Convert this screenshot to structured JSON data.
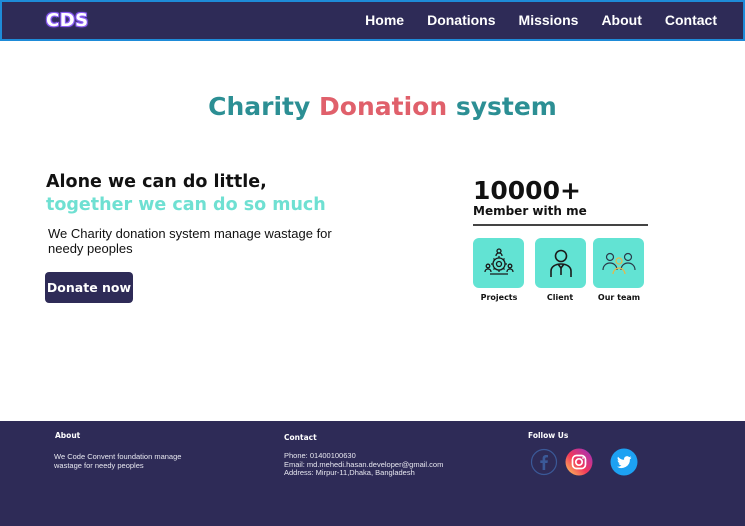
{
  "header": {
    "logo": "CDS",
    "nav": [
      "Home",
      "Donations",
      "Missions",
      "About",
      "Contact"
    ]
  },
  "hero": {
    "title_part1": "Charity",
    "title_part2": "Donation",
    "title_part3": "system"
  },
  "intro": {
    "tagline_line1": "Alone we can do little,",
    "tagline_line2": "together we can do so much",
    "description": "We Charity donation system manage wastage for needy peoples",
    "button_label": "Donate now"
  },
  "stats": {
    "count": "10000+",
    "label": "Member with me",
    "cards": [
      {
        "label": "Projects",
        "icon": "gear-people-icon"
      },
      {
        "label": "Client",
        "icon": "person-icon"
      },
      {
        "label": "Our team",
        "icon": "team-icon"
      }
    ]
  },
  "footer": {
    "about_heading": "About",
    "about_text": "We Code Convent foundation manage wastage for needy peoples",
    "contact_heading": "Contact",
    "phone": "Phone: 01400100630",
    "email": "Email: md.mehedi.hasan.developer@gmail.com",
    "address": "Address: Mirpur-11,Dhaka, Bangladesh",
    "follow_heading": "Follow Us",
    "social": [
      "facebook-icon",
      "instagram-icon",
      "twitter-icon"
    ]
  },
  "colors": {
    "navy": "#2e2b57",
    "teal": "#2c8f94",
    "coral": "#e0606b",
    "mint": "#62e3d3"
  }
}
